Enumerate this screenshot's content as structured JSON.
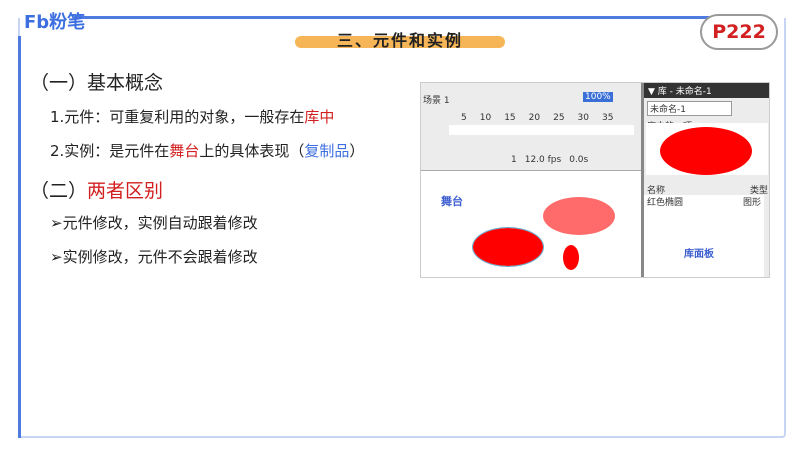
{
  "logo": "Fb粉笔",
  "title": "三、元件和实例",
  "page_badge": "P222",
  "section1": "（一）基本概念",
  "item1": {
    "prefix": "1.元件：可重复利用的对象，一般存在",
    "highlight": "库中"
  },
  "item2": {
    "prefix": "2.实例：是元件在",
    "highlight1": "舞台",
    "middle": "上的具体表现（",
    "highlight2": "复制品",
    "suffix": "）"
  },
  "section2": {
    "prefix": "（二）",
    "highlight": "两者区别"
  },
  "bullets": [
    "元件修改，实例自动跟着修改",
    "实例修改，元件不会跟着修改"
  ],
  "screenshot": {
    "scene": "场景 1",
    "zoom": "100%",
    "frame_ticks": [
      "5",
      "10",
      "15",
      "20",
      "25",
      "30",
      "35"
    ],
    "frame": "1",
    "fps": "12.0 fps",
    "time": "0.0s",
    "stage_label": "舞台",
    "library_title": "▼ 库 - 未命名-1",
    "library_select": "未命名-1",
    "library_preview_label": "库中的一项",
    "col_name": "名称",
    "col_type": "类型",
    "item_name": "红色椭圆",
    "item_type": "图形",
    "library_label": "库面板"
  }
}
